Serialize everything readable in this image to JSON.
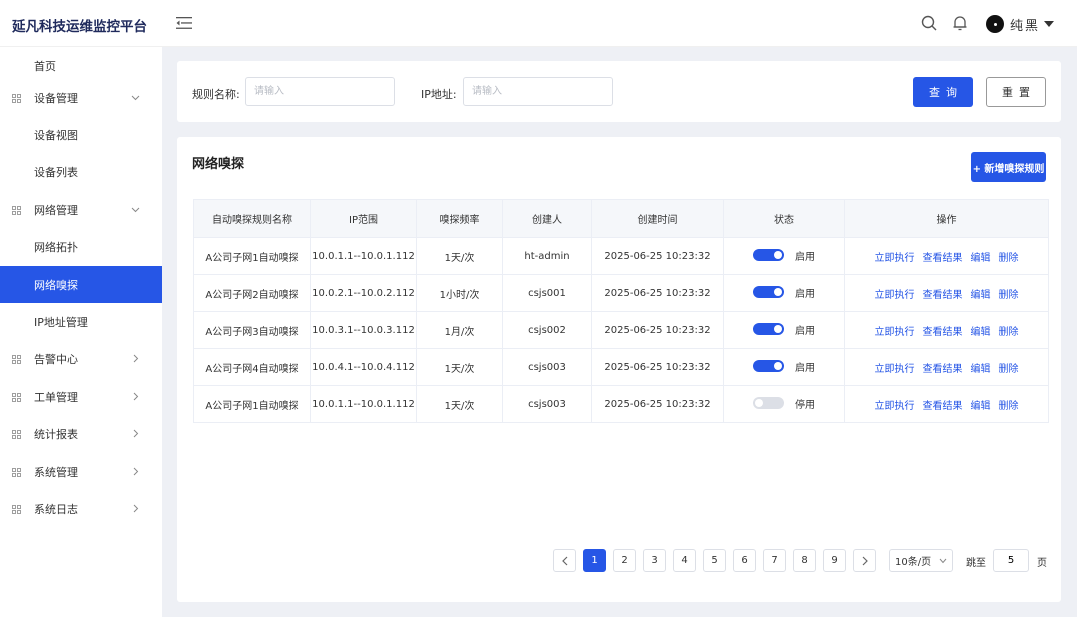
{
  "app": {
    "title": "延凡科技运维监控平台"
  },
  "header": {
    "user_name": "纯黑"
  },
  "sidebar": {
    "items": [
      {
        "label": "首页",
        "icon": false,
        "chevron": ""
      },
      {
        "label": "设备管理",
        "icon": true,
        "chevron": "down"
      },
      {
        "label": "设备视图",
        "icon": false,
        "chevron": ""
      },
      {
        "label": "设备列表",
        "icon": false,
        "chevron": ""
      },
      {
        "label": "网络管理",
        "icon": true,
        "chevron": "down"
      },
      {
        "label": "网络拓扑",
        "icon": false,
        "chevron": ""
      },
      {
        "label": "网络嗅探",
        "icon": false,
        "chevron": "",
        "active": true
      },
      {
        "label": "IP地址管理",
        "icon": false,
        "chevron": ""
      },
      {
        "label": "告警中心",
        "icon": true,
        "chevron": "right"
      },
      {
        "label": "工单管理",
        "icon": true,
        "chevron": "right"
      },
      {
        "label": "统计报表",
        "icon": true,
        "chevron": "right"
      },
      {
        "label": "系统管理",
        "icon": true,
        "chevron": "right"
      },
      {
        "label": "系统日志",
        "icon": true,
        "chevron": "right"
      }
    ]
  },
  "filter": {
    "rule_name_label": "规则名称:",
    "rule_name_placeholder": "请输入",
    "ip_label": "IP地址:",
    "ip_placeholder": "请输入",
    "query_label": "查询",
    "reset_label": "重置"
  },
  "main": {
    "title": "网络嗅探",
    "add_label": "+ 新增嗅探规则"
  },
  "table": {
    "columns": [
      "自动嗅探规则名称",
      "IP范围",
      "嗅探频率",
      "创建人",
      "创建时间",
      "状态",
      "操作"
    ],
    "actions": [
      "立即执行",
      "查看结果",
      "编辑",
      "删除"
    ],
    "rows": [
      {
        "name": "A公司子网1自动嗅探",
        "ip_range": "10.0.1.1--10.0.1.112",
        "freq": "1天/次",
        "creator": "ht-admin",
        "created": "2025-06-25 10:23:32",
        "enabled": true,
        "status": "启用"
      },
      {
        "name": "A公司子网2自动嗅探",
        "ip_range": "10.0.2.1--10.0.2.112",
        "freq": "1小时/次",
        "creator": "csjs001",
        "created": "2025-06-25 10:23:32",
        "enabled": true,
        "status": "启用"
      },
      {
        "name": "A公司子网3自动嗅探",
        "ip_range": "10.0.3.1--10.0.3.112",
        "freq": "1月/次",
        "creator": "csjs002",
        "created": "2025-06-25 10:23:32",
        "enabled": true,
        "status": "启用"
      },
      {
        "name": "A公司子网4自动嗅探",
        "ip_range": "10.0.4.1--10.0.4.112",
        "freq": "1天/次",
        "creator": "csjs003",
        "created": "2025-06-25 10:23:32",
        "enabled": true,
        "status": "启用"
      },
      {
        "name": "A公司子网1自动嗅探",
        "ip_range": "10.0.1.1--10.0.1.112",
        "freq": "1天/次",
        "creator": "csjs003",
        "created": "2025-06-25 10:23:32",
        "enabled": false,
        "status": "停用"
      }
    ]
  },
  "pagination": {
    "pages": [
      "1",
      "2",
      "3",
      "4",
      "5",
      "6",
      "7",
      "8",
      "9"
    ],
    "current": "1",
    "page_size": "10条/页",
    "jump_label": "跳至",
    "jump_value": "5",
    "page_label": "页"
  },
  "colors": {
    "primary": "#2656e6",
    "brand_text": "#1f2a5c"
  }
}
